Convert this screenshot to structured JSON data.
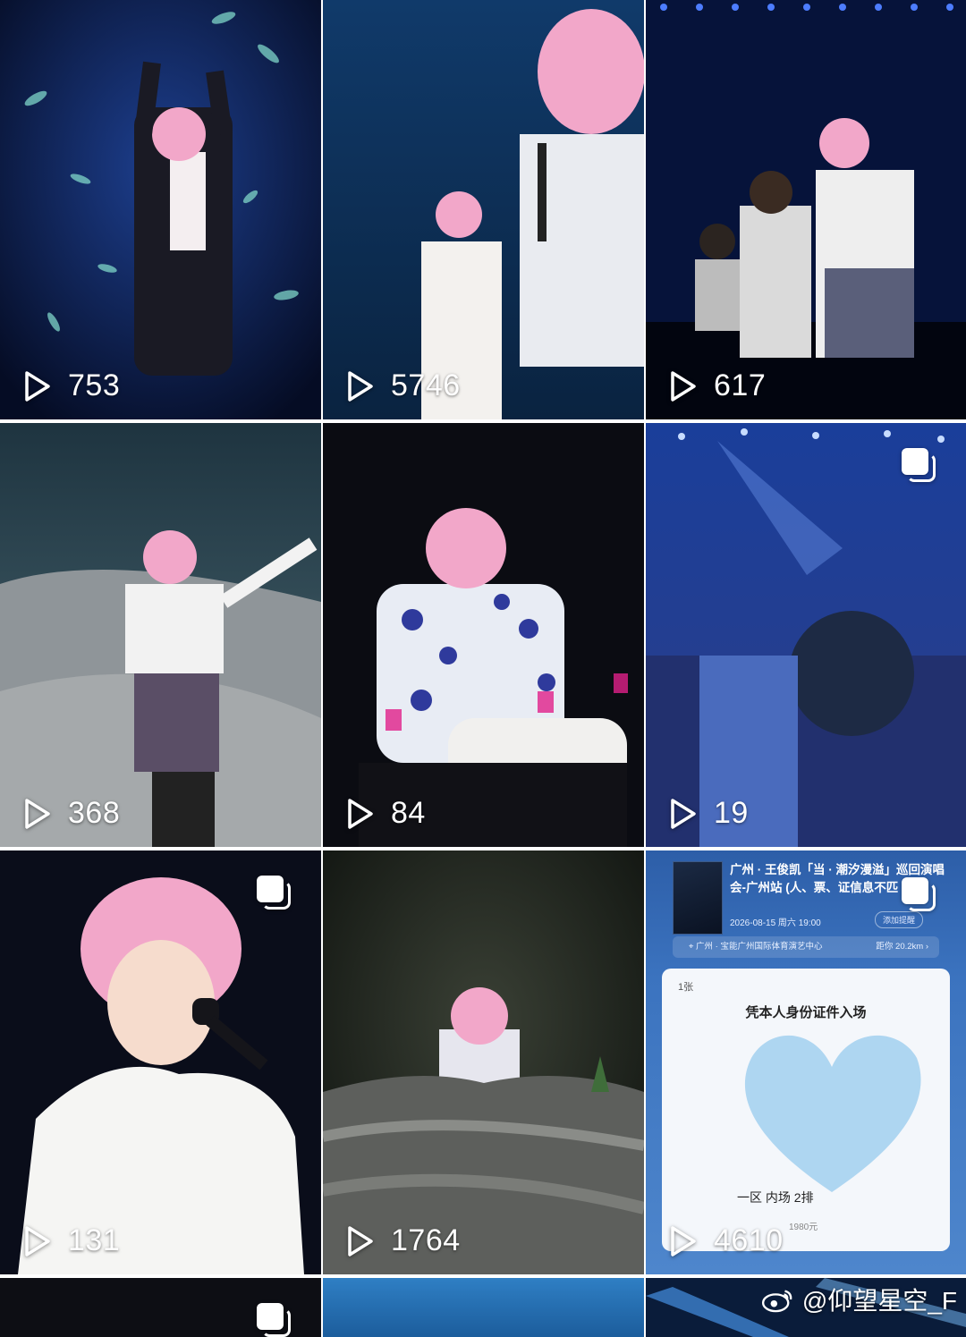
{
  "tiles": [
    {
      "views": "753",
      "type": "video"
    },
    {
      "views": "5746",
      "type": "video"
    },
    {
      "views": "617",
      "type": "video"
    },
    {
      "views": "368",
      "type": "video"
    },
    {
      "views": "84",
      "type": "video"
    },
    {
      "views": "19",
      "type": "video",
      "multi": true
    },
    {
      "views": "131",
      "type": "video",
      "multi": true
    },
    {
      "views": "1764",
      "type": "video"
    },
    {
      "views": "4610",
      "type": "video",
      "multi": true
    }
  ],
  "ticket": {
    "title": "广州 · 王俊凯「当 · 潮汐漫溢」巡回演唱会-广州站 (人、票、证信息不匹",
    "datetime": "2026-08-15 周六 19:00",
    "remind": "添加提醒",
    "venue": "广州 · 宝能广州国际体育演艺中心",
    "distance": "距你 20.2km  ›",
    "count": "1张",
    "notice": "凭本人身份证件入场",
    "seat": "一区 内场 2排",
    "price": "1980元"
  },
  "watermark": "@仰望星空_F",
  "icons": {
    "play": "play-icon",
    "multi": "multi-image-icon",
    "weibo": "weibo-logo-icon",
    "location": "location-pin-icon"
  },
  "colors": {
    "overlay_text": "#ffffff",
    "stage_blue": "#0d2a66",
    "hair_pink": "#f2a7c9"
  }
}
